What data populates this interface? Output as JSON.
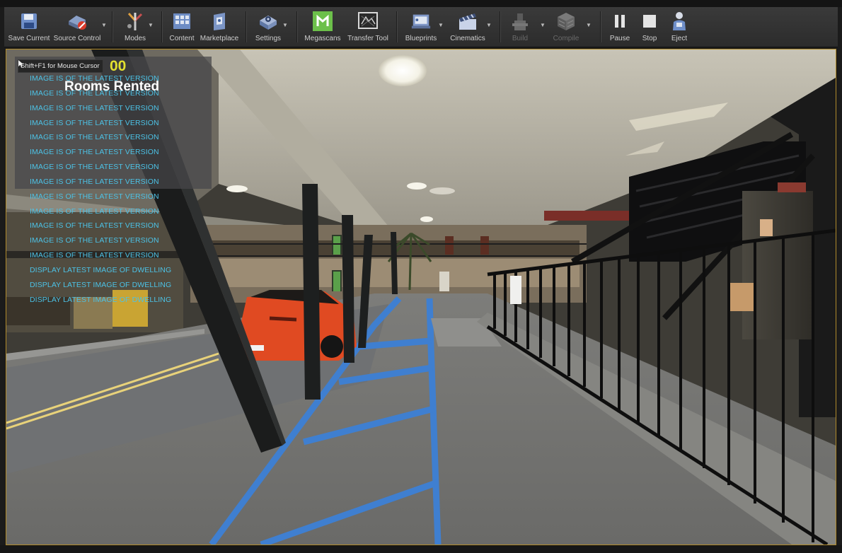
{
  "toolbar": {
    "items": [
      {
        "label": "Save Current",
        "icon": "save-icon"
      },
      {
        "label": "Source Control",
        "icon": "source-control-icon"
      },
      {
        "label": "Modes",
        "icon": "modes-icon"
      },
      {
        "label": "Content",
        "icon": "content-icon"
      },
      {
        "label": "Marketplace",
        "icon": "marketplace-icon"
      },
      {
        "label": "Settings",
        "icon": "settings-icon"
      },
      {
        "label": "Megascans",
        "icon": "megascans-icon"
      },
      {
        "label": "Transfer Tool",
        "icon": "transfer-tool-icon"
      },
      {
        "label": "Blueprints",
        "icon": "blueprints-icon"
      },
      {
        "label": "Cinematics",
        "icon": "cinematics-icon"
      },
      {
        "label": "Build",
        "icon": "build-icon"
      },
      {
        "label": "Compile",
        "icon": "compile-icon"
      },
      {
        "label": "Pause",
        "icon": "pause-icon"
      },
      {
        "label": "Stop",
        "icon": "stop-icon"
      },
      {
        "label": "Eject",
        "icon": "eject-icon"
      }
    ]
  },
  "viewport": {
    "mouse_hint": "Shift+F1 for Mouse Cursor",
    "counter_fragment": "00",
    "rooms_rented_label": "Rooms Rented",
    "debug_lines": [
      "IMAGE IS OF THE LATEST VERSION",
      "IMAGE IS OF THE LATEST VERSION",
      "IMAGE IS OF THE LATEST VERSION",
      "IMAGE IS OF THE LATEST VERSION",
      "IMAGE IS OF THE LATEST VERSION",
      "IMAGE IS OF THE LATEST VERSION",
      "IMAGE IS OF THE LATEST VERSION",
      "IMAGE IS OF THE LATEST VERSION",
      "IMAGE IS OF THE LATEST VERSION",
      "IMAGE IS OF THE LATEST VERSION",
      "IMAGE IS OF THE LATEST VERSION",
      "IMAGE IS OF THE LATEST VERSION",
      "IMAGE IS OF THE LATEST VERSION",
      "DISPLAY LATEST IMAGE OF DWELLING",
      "DISPLAY LATEST IMAGE OF DWELLING",
      "DISPLAY LATEST IMAGE OF DWELLING"
    ]
  },
  "colors": {
    "viewport_border": "#b08a2a",
    "debug_text": "#4cc2e6",
    "counter_text": "#e2e030",
    "megascans_green": "#6cc04a",
    "car_red": "#e04a22",
    "parking_blue": "#3f7fd0"
  }
}
